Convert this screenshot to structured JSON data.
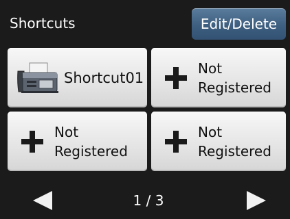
{
  "header": {
    "title": "Shortcuts",
    "edit_button": "Edit/Delete"
  },
  "shortcuts": [
    {
      "label": "Shortcut01",
      "icon": "fax-machine-icon"
    },
    {
      "label": "Not\nRegistered",
      "icon": "plus-icon"
    },
    {
      "label": "Not\nRegistered",
      "icon": "plus-icon"
    },
    {
      "label": "Not\nRegistered",
      "icon": "plus-icon"
    }
  ],
  "pager": {
    "indicator": "1 / 3",
    "prev_icon": "left-arrow-icon",
    "next_icon": "right-arrow-icon"
  },
  "colors": {
    "background": "#1b1b1b",
    "accent_button": "#3e5f80",
    "tile": "#e4e4e4"
  }
}
